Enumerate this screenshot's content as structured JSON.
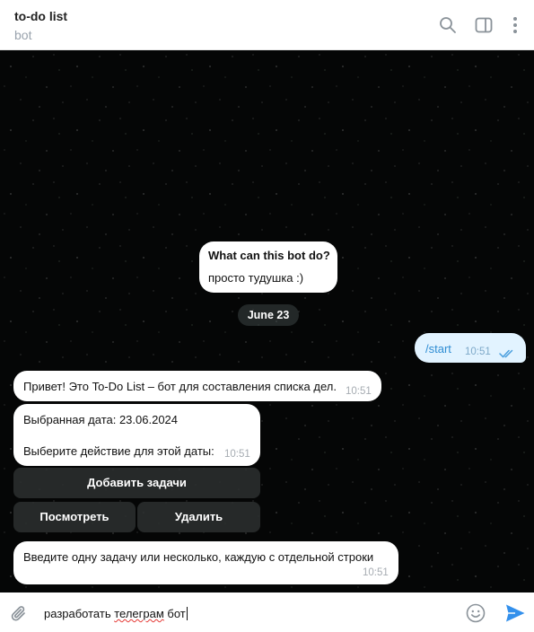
{
  "header": {
    "title": "to-do list",
    "subtitle": "bot",
    "icons": [
      "search-icon",
      "sidebar-toggle-icon",
      "more-vertical-icon"
    ]
  },
  "chat": {
    "bot_info": {
      "title": "What can this bot do?",
      "description": "просто тудушка :)"
    },
    "date_separator": "June 23",
    "outgoing": {
      "text": "/start",
      "time": "10:51",
      "status": "read"
    },
    "messages": [
      {
        "text": "Привет! Это To-Do List – бот для составления списка дел.",
        "time": "10:51"
      },
      {
        "line1": "Выбранная дата: 23.06.2024",
        "line2": "Выберите действие для этой даты:",
        "time": "10:51"
      },
      {
        "text": "Введите одну задачу или несколько, каждую с отдельной строки",
        "time": "10:51"
      }
    ],
    "keyboard": {
      "add_task": "Добавить задачи",
      "view": "Посмотреть",
      "delete": "Удалить"
    }
  },
  "composer": {
    "value_plain": "разработать ",
    "value_underlined": "телеграм",
    "value_tail": " бот",
    "icons": [
      "paperclip-icon",
      "emoji-icon",
      "send-icon"
    ],
    "send_color": "#3390ec"
  },
  "colors": {
    "outgoing_bubble": "#e2f3ff",
    "outgoing_text": "#2f8dd3",
    "chat_background": "#050606"
  }
}
